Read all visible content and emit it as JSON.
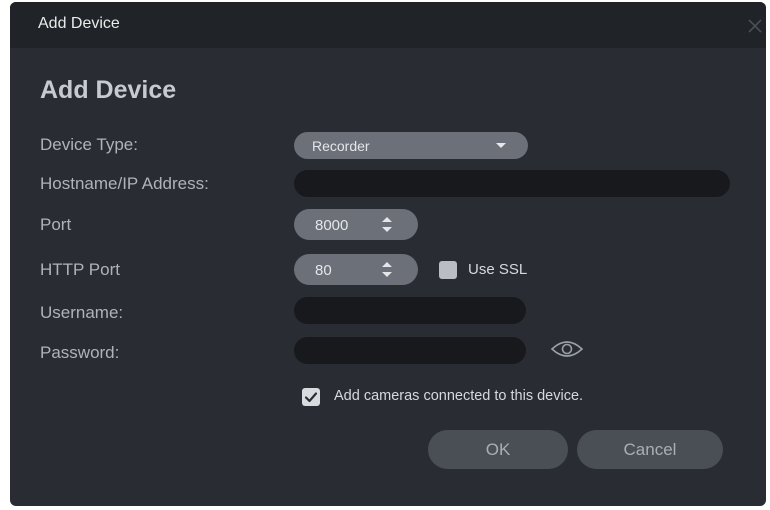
{
  "window": {
    "title": "Add Device",
    "close_icon": "close-icon"
  },
  "heading": "Add Device",
  "fields": {
    "device_type": {
      "label": "Device Type:",
      "value": "Recorder"
    },
    "hostname": {
      "label": "Hostname/IP Address:",
      "value": ""
    },
    "port": {
      "label": "Port",
      "value": "8000"
    },
    "http_port": {
      "label": "HTTP Port",
      "value": "80"
    },
    "use_ssl": {
      "label": "Use SSL",
      "checked": false
    },
    "username": {
      "label": "Username:",
      "value": ""
    },
    "password": {
      "label": "Password:",
      "value": "",
      "reveal_icon": "eye-icon"
    },
    "add_cameras": {
      "label": "Add cameras connected to this device.",
      "checked": true
    }
  },
  "buttons": {
    "ok": "OK",
    "cancel": "Cancel"
  },
  "colors": {
    "dialog_bg": "#292d33",
    "titlebar_bg": "#202327",
    "control_bg": "#6b7079",
    "input_bg": "#17191c",
    "button_bg": "#4a4f56"
  }
}
